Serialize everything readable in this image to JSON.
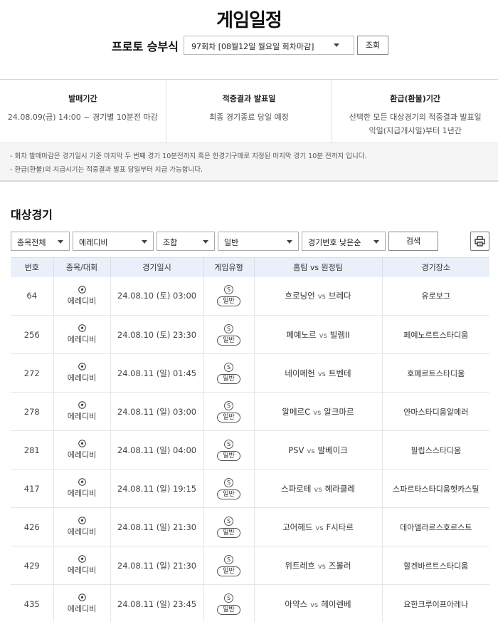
{
  "page_title": "게임일정",
  "round": {
    "label": "프로토 승부식",
    "selected": "97회차 [08월12일 월요일 회차마감]",
    "query_button": "조회"
  },
  "info": [
    {
      "title": "발매기간",
      "lines": [
        "24.08.09(금) 14:00 ~ 경기별 10분전 마감"
      ]
    },
    {
      "title": "적중결과 발표일",
      "lines": [
        "최종 경기종료 당일 예정"
      ]
    },
    {
      "title": "환급(환불)기간",
      "lines": [
        "선택한 모든 대상경기의 적중결과 발표일",
        "익일(지급개시일)부터 1년간"
      ]
    }
  ],
  "notes": [
    "- 회차 발매마감은 경기일시 기준 마지막 두 번째 경기 10분전까지 혹은 한경기구매로 지정된 마지막 경기 10분 전까지 입니다.",
    "- 환급(환불)의 지급시기는 적중결과 발표 당일부터 지급 가능합니다."
  ],
  "section_title": "대상경기",
  "filters": {
    "sport": "종목전체",
    "league": "에레디비",
    "combo": "조합",
    "type": "일반",
    "sort": "경기번호 낮은순",
    "search_button": "검색"
  },
  "table": {
    "headers": [
      "번호",
      "종목/대회",
      "경기일시",
      "게임유형",
      "홈팀 vs 원정팀",
      "경기장소"
    ],
    "vs_label": "vs",
    "type_symbol": "S",
    "rows": [
      {
        "no": "64",
        "league": "에레디비",
        "datetime": "24.08.10 (토) 03:00",
        "type": "일반",
        "home": "흐로닝언",
        "away": "브레다",
        "venue": "유로보그"
      },
      {
        "no": "256",
        "league": "에레디비",
        "datetime": "24.08.10 (토) 23:30",
        "type": "일반",
        "home": "페예노르",
        "away": "빌렘II",
        "venue": "페예노르트스타디움"
      },
      {
        "no": "272",
        "league": "에레디비",
        "datetime": "24.08.11 (일) 01:45",
        "type": "일반",
        "home": "네이메헌",
        "away": "트벤테",
        "venue": "호페르트스타디움"
      },
      {
        "no": "278",
        "league": "에레디비",
        "datetime": "24.08.11 (일) 03:00",
        "type": "일반",
        "home": "알메르C",
        "away": "알크마르",
        "venue": "얀마스타디움알메러"
      },
      {
        "no": "281",
        "league": "에레디비",
        "datetime": "24.08.11 (일) 04:00",
        "type": "일반",
        "home": "PSV",
        "away": "발베이크",
        "venue": "필립스스타디움"
      },
      {
        "no": "417",
        "league": "에레디비",
        "datetime": "24.08.11 (일) 19:15",
        "type": "일반",
        "home": "스파로테",
        "away": "헤라클레",
        "venue": "스파르타스타디움헷카스틸"
      },
      {
        "no": "426",
        "league": "에레디비",
        "datetime": "24.08.11 (일) 21:30",
        "type": "일반",
        "home": "고어헤드",
        "away": "F시타르",
        "venue": "데아델라르스호르스트"
      },
      {
        "no": "429",
        "league": "에레디비",
        "datetime": "24.08.11 (일) 21:30",
        "type": "일반",
        "home": "위트레흐",
        "away": "즈볼러",
        "venue": "할겐바르트스타디움"
      },
      {
        "no": "435",
        "league": "에레디비",
        "datetime": "24.08.11 (일) 23:45",
        "type": "일반",
        "home": "아약스",
        "away": "헤이렌베",
        "venue": "요한크루이프아레나"
      }
    ]
  }
}
